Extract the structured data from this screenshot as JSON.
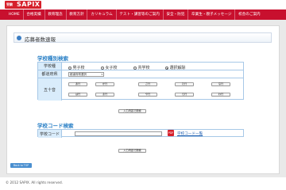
{
  "header": {
    "logo_small": "受験",
    "logo_main": "SAPIX"
  },
  "nav": {
    "items": [
      "HOME",
      "合格実績",
      "教育理念",
      "教育方針",
      "カリキュラム",
      "テスト・講習等のご案内",
      "安全・防犯",
      "卒業生・親子メッセージ",
      "校舎のご案内"
    ]
  },
  "page": {
    "title": "応募者数速報"
  },
  "school_type_search": {
    "section_title": "学校種別検索",
    "labels": {
      "school_type": "学校種",
      "prefecture": "都道府県",
      "kana": "五十音"
    },
    "radios": [
      {
        "label": "男子校",
        "checked": false
      },
      {
        "label": "女子校",
        "checked": false
      },
      {
        "label": "共学校",
        "checked": false
      },
      {
        "label": "選択解除",
        "checked": true
      }
    ],
    "prefecture_select_value": "都道府県選択",
    "kana_row1": [
      "あ行",
      "か行",
      "さ行",
      "た行",
      "な行"
    ],
    "kana_row2": [
      "は行",
      "ま行",
      "や行",
      "ら行",
      "わ行"
    ],
    "search_button": "入力内容で検索"
  },
  "school_code_search": {
    "section_title": "学校コード検索",
    "label": "学校コード",
    "input_value": "",
    "pdf_icon": "PDF",
    "code_list_link": "学校コード一覧",
    "search_button": "入力内容で検索"
  },
  "back_button": "Back to TOP",
  "footer": {
    "copyright": "© 2012 SAPIX. All rights reserved."
  },
  "colors": {
    "brand_red": "#c8102e",
    "accent_blue": "#2a80c6",
    "label_bg": "#d9ecfb"
  }
}
